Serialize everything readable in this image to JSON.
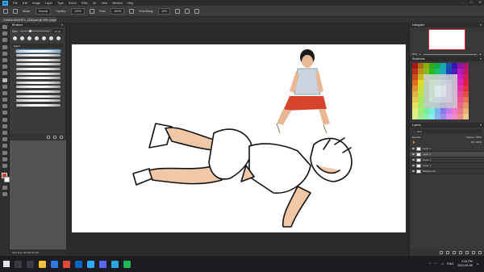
{
  "menubar": {
    "app_logo": "Ps",
    "items": [
      "File",
      "Edit",
      "Image",
      "Layer",
      "Type",
      "Select",
      "Filter",
      "3D",
      "View",
      "Window",
      "Help"
    ],
    "window_controls": [
      "–",
      "□",
      "✕"
    ]
  },
  "options_bar": {
    "mode_label": "Mode:",
    "mode_value": "Normal",
    "opacity_label": "Opacity:",
    "opacity_value": "100%",
    "flow_label": "Flow:",
    "flow_value": "100%",
    "smoothing_label": "Smoothing:",
    "smoothing_value": "10%"
  },
  "document": {
    "tab_title": "CHARA MAGNIT0_1248.psd @ 33% (Layer 1, RGB/8)"
  },
  "brushes_panel": {
    "title": "Brushes",
    "size_label": "Size:",
    "size_value": "10 px",
    "group_label": "Kyle's"
  },
  "status": {
    "zoom": "33%",
    "doc_size": "Doc: 48.5M/736.4M"
  },
  "navigator_panel": {
    "title": "Navigator",
    "zoom": "33%"
  },
  "swatches_panel": {
    "title": "Swatches"
  },
  "layers_panel": {
    "title": "Layers",
    "kind_label": "Kind",
    "blend_mode": "Normal",
    "opacity_label": "Opacity: 100%",
    "fill_label": "Fill: 100%",
    "layers": [
      {
        "name": "Layer 1"
      },
      {
        "name": "Layer 1"
      },
      {
        "name": "Layer 1"
      },
      {
        "name": "Layer 1"
      },
      {
        "name": "Background"
      }
    ]
  },
  "taskbar": {
    "time": "2:05 PM",
    "date": "2023-09-08",
    "lang": "ENG"
  },
  "colors": {
    "accent": "#31a8ff",
    "foreground": "#c8413a",
    "background": "#ffffff"
  }
}
